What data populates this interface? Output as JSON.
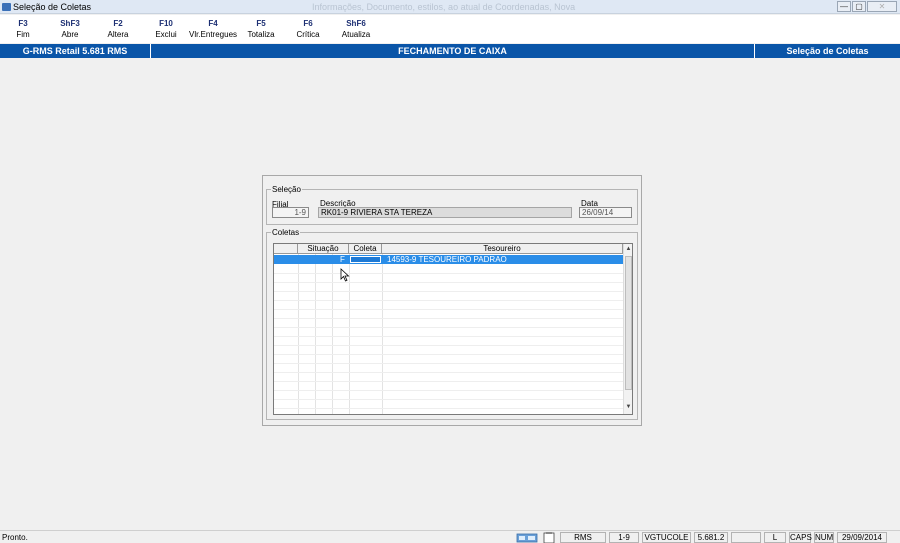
{
  "window": {
    "title": "Seleção de Coletas",
    "faded_title": "Informações, Documento, estilos, ao atual de Coordenadas, Nova",
    "controls": {
      "minimize": "—",
      "maximize": "▢",
      "close": "✕"
    }
  },
  "toolbar": {
    "keys": [
      {
        "key": "F3",
        "label": "Fim"
      },
      {
        "key": "ShF3",
        "label": "Abre"
      },
      {
        "key": "F2",
        "label": "Altera"
      },
      {
        "key": "F10",
        "label": "Exclui"
      },
      {
        "key": "F4",
        "label": "Vlr.Entregues"
      },
      {
        "key": "F5",
        "label": "Totaliza"
      },
      {
        "key": "F6",
        "label": "Crítica"
      },
      {
        "key": "ShF6",
        "label": "Atualiza"
      }
    ]
  },
  "header": {
    "left": "G-RMS Retail 5.681 RMS",
    "center": "FECHAMENTO DE CAIXA",
    "right": "Seleção de Coletas"
  },
  "selecao": {
    "group_title": "Seleção",
    "filial_label": "Filial",
    "filial_value": "1-9",
    "descricao_label": "Descrição",
    "descricao_value": "RK01-9 RIVIERA STA TEREZA",
    "data_label": "Data",
    "data_value": "26/09/14"
  },
  "coletas": {
    "group_title": "Coletas",
    "columns": {
      "situacao": "Situação",
      "coleta": "Coleta",
      "tesoureiro": "Tesoureiro"
    },
    "rows": [
      {
        "situacao": "F",
        "coleta": "",
        "tesoureiro": "14593-9 TESOUREIRO PADRAO"
      }
    ]
  },
  "status": {
    "message": "Pronto.",
    "panels": [
      "RMS",
      "1-9",
      "VGTUCOLE",
      "5.681.2",
      "",
      "L",
      "CAPS",
      "NUM",
      "29/09/2014"
    ]
  },
  "colors": {
    "header_blue": "#0a55a8",
    "selection_blue": "#2a8de8",
    "fkey_navy": "#1c2f73"
  }
}
